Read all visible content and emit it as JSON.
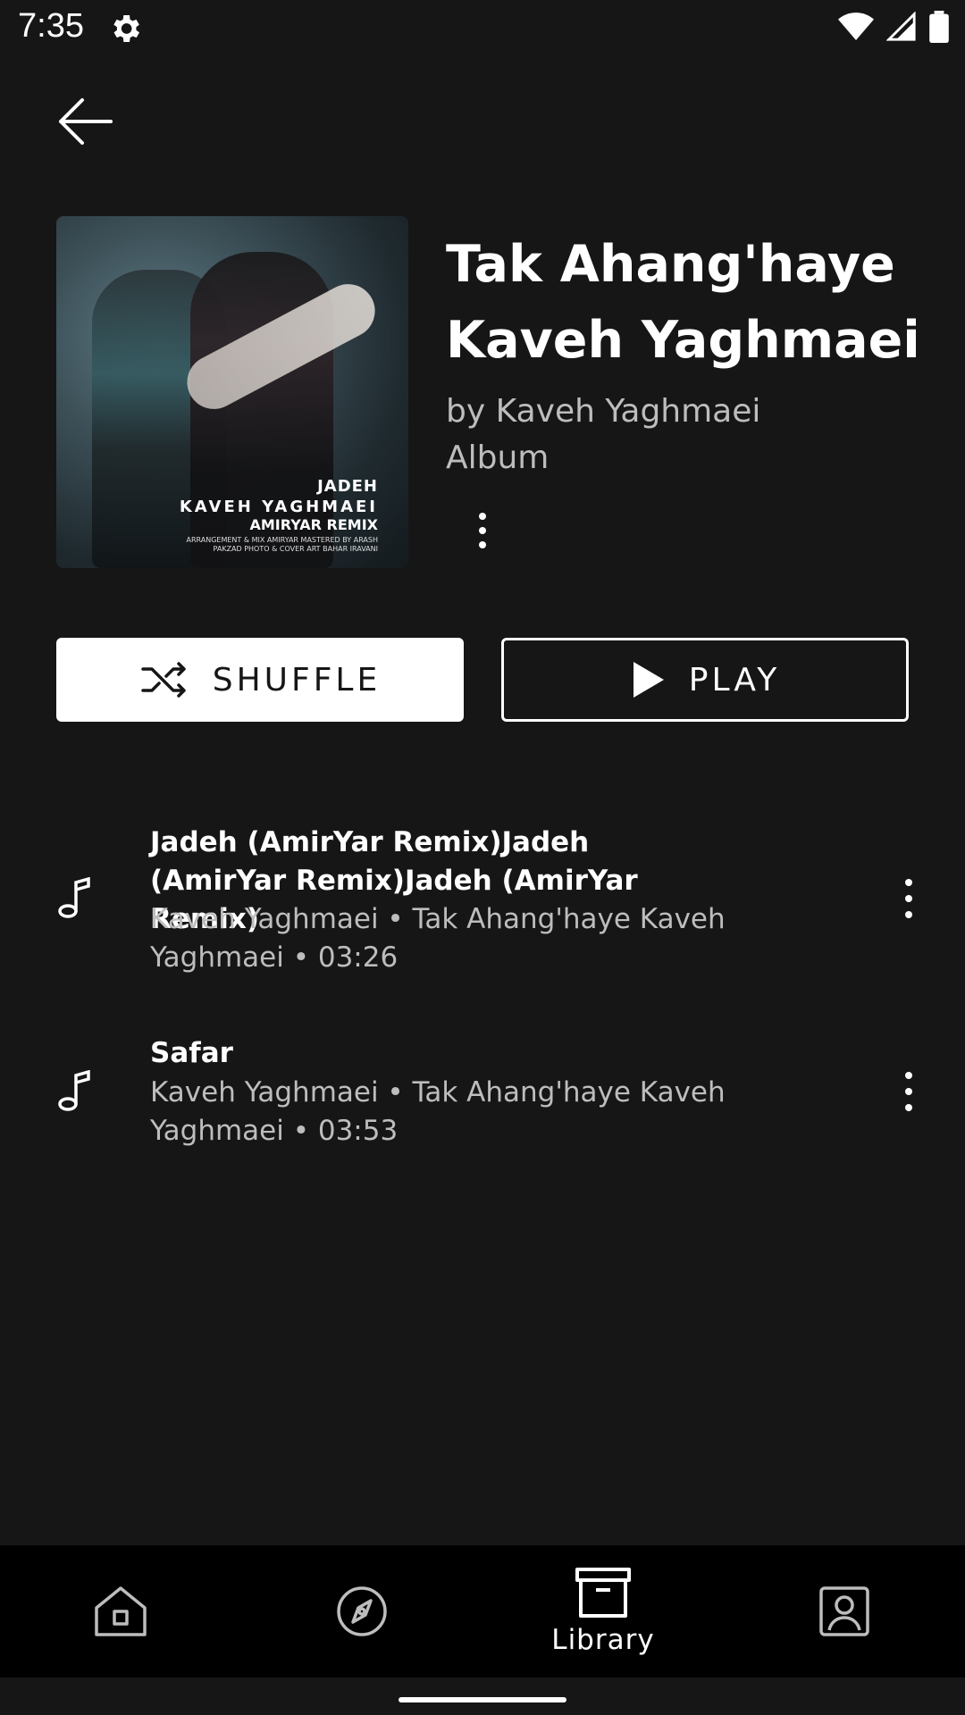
{
  "status_bar": {
    "time": "7:35",
    "icons": [
      "settings-icon",
      "wifi-icon",
      "signal-icon",
      "battery-icon"
    ]
  },
  "header": {
    "back_icon": "arrow-left-icon"
  },
  "album": {
    "title": "Tak Ahang'haye Kaveh Yaghmaei",
    "artist_line": "by Kaveh Yaghmaei",
    "type": "Album",
    "cover_text": {
      "line1": "JADEH",
      "line2": "KAVEH YAGHMAEI",
      "line3": "AMIRYAR REMIX",
      "credits": "ARRANGEMENT & MIX  AMIRYAR  MASTERED BY  ARASH PAKZAD  PHOTO & COVER ART  BAHAR IRAVANI"
    }
  },
  "actions": {
    "shuffle_label": "SHUFFLE",
    "play_label": "PLAY"
  },
  "tracks": [
    {
      "title": "Jadeh (AmirYar Remix)Jadeh (AmirYar Remix)Jadeh (AmirYar Remix)",
      "meta": "Kaveh Yaghmaei • Tak Ahang'haye Kaveh Yaghmaei • 03:26"
    },
    {
      "title": "Safar",
      "meta": "Kaveh Yaghmaei  • Tak Ahang'haye Kaveh Yaghmaei  • 03:53"
    }
  ],
  "nav": {
    "items": [
      {
        "icon": "home-icon",
        "label": ""
      },
      {
        "icon": "explore-compass-icon",
        "label": ""
      },
      {
        "icon": "library-archive-icon",
        "label": "Library"
      },
      {
        "icon": "profile-icon",
        "label": ""
      }
    ],
    "active_index": 2
  },
  "colors": {
    "background": "#161616",
    "text_primary": "#ffffff",
    "text_secondary": "#bdbdbd",
    "nav_background": "#000000"
  }
}
